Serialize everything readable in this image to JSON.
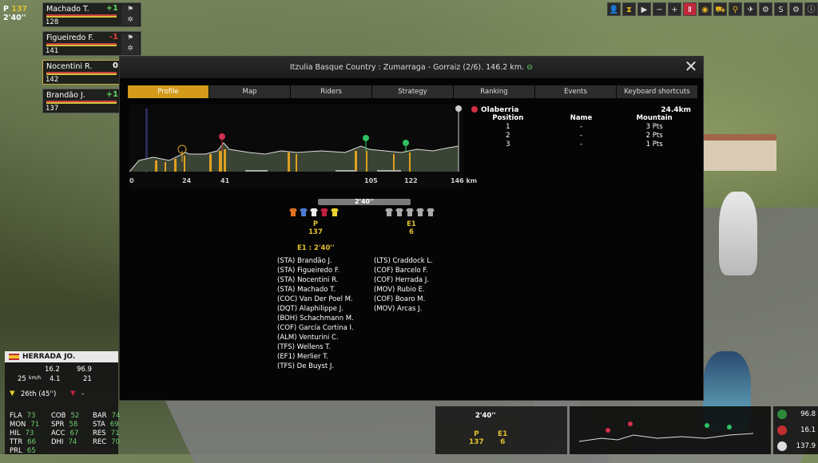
{
  "top_left": {
    "prefix": "P",
    "number": "137",
    "gap": "2'40''"
  },
  "riders": [
    {
      "name": "Machado T.",
      "gain": "+1",
      "energy": "128",
      "gain_color": "#5fd35f"
    },
    {
      "name": "Figueiredo F.",
      "gain": "-1",
      "energy": "141",
      "gain_color": "#e04040"
    },
    {
      "name": "Nocentini R.",
      "gain": "0",
      "energy": "142",
      "gain_color": "#ffffff"
    },
    {
      "name": "Brandão J.",
      "gain": "+1",
      "energy": "137",
      "gain_color": "#5fd35f"
    }
  ],
  "dialog": {
    "title": "Itzulia Basque Country : Zumarraga  -  Gorraiz (2/6). 146.2 km.",
    "tabs": [
      "Profile",
      "Map",
      "Riders",
      "Strategy",
      "Ranking",
      "Events",
      "Keyboard shortcuts"
    ],
    "active_tab": "Profile",
    "km_labels": [
      "0",
      "24",
      "41",
      "105",
      "122",
      "146 km"
    ],
    "climb": {
      "name": "Olaberria",
      "distance": "24.4km",
      "headers": [
        "Position",
        "Name",
        "Mountain"
      ],
      "rows": [
        [
          "1",
          "-",
          "3 Pts"
        ],
        [
          "2",
          "-",
          "2 Pts"
        ],
        [
          "3",
          "-",
          "1 Pts"
        ]
      ]
    },
    "groups": {
      "gap_bar": "2'40''",
      "g1": {
        "label": "P",
        "count": "137"
      },
      "g2": {
        "label": "E1",
        "count": "6"
      },
      "header": "E1 : 2'40''",
      "left": [
        "(STA) Brandão J.",
        "(STA) Figueiredo F.",
        "(STA) Nocentini R.",
        "(STA) Machado T.",
        "(COC) Van Der Poel M.",
        "(DQT) Alaphilippe J.",
        "(BOH) Schachmann M.",
        "(COF) García Cortina I.",
        "(ALM) Venturini C.",
        "(TFS) Wellens T.",
        "(EF1) Merlier T.",
        "(TFS) De Buyst J."
      ],
      "right": [
        "(LTS) Craddock L.",
        "(COF) Barcelo F.",
        "(COF) Herrada J.",
        "(MOV) Rubio E.",
        "(COF) Boaro M.",
        "(MOV) Arcas J."
      ]
    }
  },
  "cyclist": {
    "name": "HERRADA JO.",
    "speed": "16.2",
    "hr": "96.9",
    "val1": "25",
    "unit": "km/h",
    "val2": "4.1",
    "val3": "21",
    "rank": "26th (45'')",
    "rank_extra": "-",
    "stats": [
      [
        "FLA",
        "73"
      ],
      [
        "COB",
        "52"
      ],
      [
        "BAR",
        "74"
      ],
      [
        "MON",
        "71"
      ],
      [
        "SPR",
        "58"
      ],
      [
        "STA",
        "69"
      ],
      [
        "HIL",
        "73"
      ],
      [
        "ACC",
        "67"
      ],
      [
        "RES",
        "71"
      ],
      [
        "TTR",
        "66"
      ],
      [
        "DHI",
        "74"
      ],
      [
        "REC",
        "70"
      ],
      [
        "PRL",
        "65"
      ]
    ]
  },
  "mini": {
    "gap": "2'40''",
    "g1_label": "P",
    "g1_count": "137",
    "g2_label": "E1",
    "g2_count": "6"
  },
  "speed_panel": [
    "96.8",
    "16.1",
    "137.9"
  ]
}
